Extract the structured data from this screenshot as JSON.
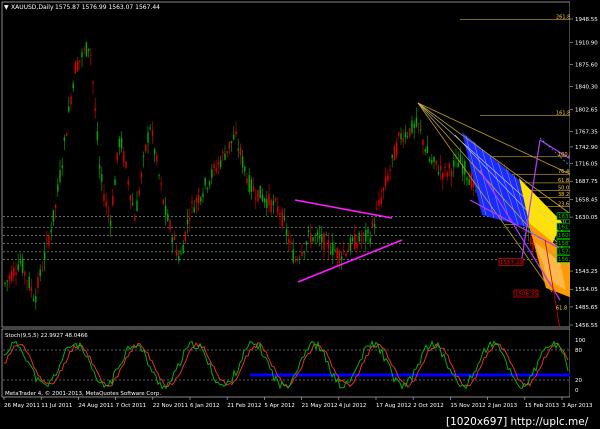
{
  "header": {
    "symbol_text": "XAUUSD,Daily",
    "ohlc_text": "1575.87 1576.99 1563.07 1567.44"
  },
  "indicator": {
    "title_text": "Stoch(9,5,5) 22.9927 48.0466"
  },
  "footer": {
    "copyright_text": "MetaTrader 4, © 2001-2013, MetaQuotes Software Corp."
  },
  "watermark_text": "[1020x697] http://uplc.me/",
  "price_axis": [
    {
      "label": "1948.55",
      "value": 1948.55
    },
    {
      "label": "1910.90",
      "value": 1910.9
    },
    {
      "label": "1875.60",
      "value": 1875.6
    },
    {
      "label": "1840.30",
      "value": 1840.3
    },
    {
      "label": "1802.65",
      "value": 1802.65
    },
    {
      "label": "1767.35",
      "value": 1767.35
    },
    {
      "label": "1742.90",
      "value": 1742.9
    },
    {
      "label": "1716.05",
      "value": 1716.05
    },
    {
      "label": "1687.75",
      "value": 1687.75
    },
    {
      "label": "1658.45",
      "value": 1658.45
    },
    {
      "label": "1630.05",
      "value": 1630.05
    },
    {
      "label": "1543.25",
      "value": 1543.25
    },
    {
      "label": "1514.05",
      "value": 1514.05
    },
    {
      "label": "1485.65",
      "value": 1485.65
    },
    {
      "label": "1456.55",
      "value": 1456.55
    }
  ],
  "stoch_axis": [
    {
      "label": "100",
      "value": 100
    },
    {
      "label": "80",
      "value": 80
    },
    {
      "label": "20",
      "value": 20
    },
    {
      "label": "0",
      "value": 0
    }
  ],
  "date_axis": [
    "26 May 2011",
    "11 Jul 2011",
    "24 Aug 2011",
    "7 Oct 2011",
    "22 Nov 2011",
    "6 Jan 2012",
    "21 Feb 2012",
    "5 Apr 2012",
    "21 May 2012",
    "4 Jul 2012",
    "17 Aug 2012",
    "2 Oct 2012",
    "15 Nov 2012",
    "2 Jan 2013",
    "15 Feb 2013",
    "3 Apr 2013"
  ],
  "fib_labels": [
    {
      "label": "261.8",
      "price": 1948.0
    },
    {
      "label": "161.8",
      "price": 1793.0
    },
    {
      "label": "100.0",
      "price": 1727.0
    },
    {
      "label": "76.4",
      "price": 1699.0
    },
    {
      "label": "61.8",
      "price": 1685.0
    },
    {
      "label": "50.0",
      "price": 1673.0
    },
    {
      "label": "38.2",
      "price": 1662.0
    },
    {
      "label": "23.6",
      "price": 1647.0
    },
    {
      "label": "0.0",
      "price": 1618.0
    },
    {
      "label": "61.8",
      "price": 1480.0
    }
  ],
  "price_boxes": [
    {
      "label": "1630.64",
      "price": 1630.6,
      "color": "#00cc00"
    },
    {
      "label": "1613.83",
      "price": 1613.8,
      "color": "#00cc00"
    },
    {
      "label": "1600.32",
      "price": 1600.3,
      "color": "#00cc00"
    },
    {
      "label": "1587.95",
      "price": 1587.9,
      "color": "#00cc00"
    },
    {
      "label": "1574.07",
      "price": 1574.1,
      "color": "#00cc00"
    },
    {
      "label": "1562.12",
      "price": 1562.1,
      "color": "#00cc00"
    },
    {
      "label": "1557.23",
      "price": 1557.2,
      "color": "#ff0000"
    },
    {
      "label": "1506.35",
      "price": 1506.4,
      "color": "#ff0000"
    }
  ],
  "colors": {
    "background": "#000000",
    "bull_candle": "#00b000",
    "bear_candle": "#e00000",
    "stoch_main": "#00c000",
    "stoch_signal": "#ff3030",
    "level_blue": "#0000ff",
    "triangle": "#ff00ff",
    "fib": "#ffd23a"
  }
}
